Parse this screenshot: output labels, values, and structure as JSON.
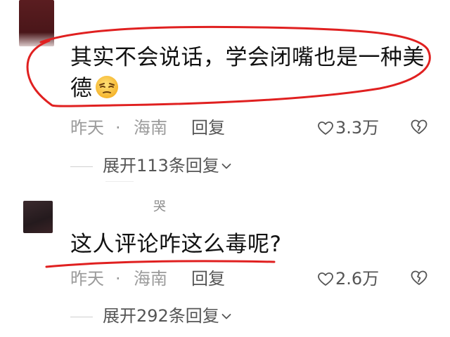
{
  "comments": [
    {
      "text_line1": "其实不会说话，学会闭嘴也是一种美",
      "text_line2": "德",
      "emoji": "squinting-face-emoji",
      "date": "昨天",
      "separator": "·",
      "location": "海南",
      "reply_label": "回复",
      "likes": "3.3万",
      "expand_label": "展开113条回复"
    },
    {
      "username_fragment": "哭",
      "text_line1": "这人评论咋这么毒呢?",
      "date": "昨天",
      "separator": "·",
      "location": "海南",
      "reply_label": "回复",
      "likes": "2.6万",
      "expand_label": "展开292条回复"
    }
  ],
  "icons": {
    "like": "heart-outline-icon",
    "dislike": "broken-heart-icon",
    "expand": "chevron-down-icon"
  },
  "colors": {
    "annotation_red": "#e02020",
    "meta_gray": "#9b9b9b",
    "text_dark": "#111111"
  }
}
